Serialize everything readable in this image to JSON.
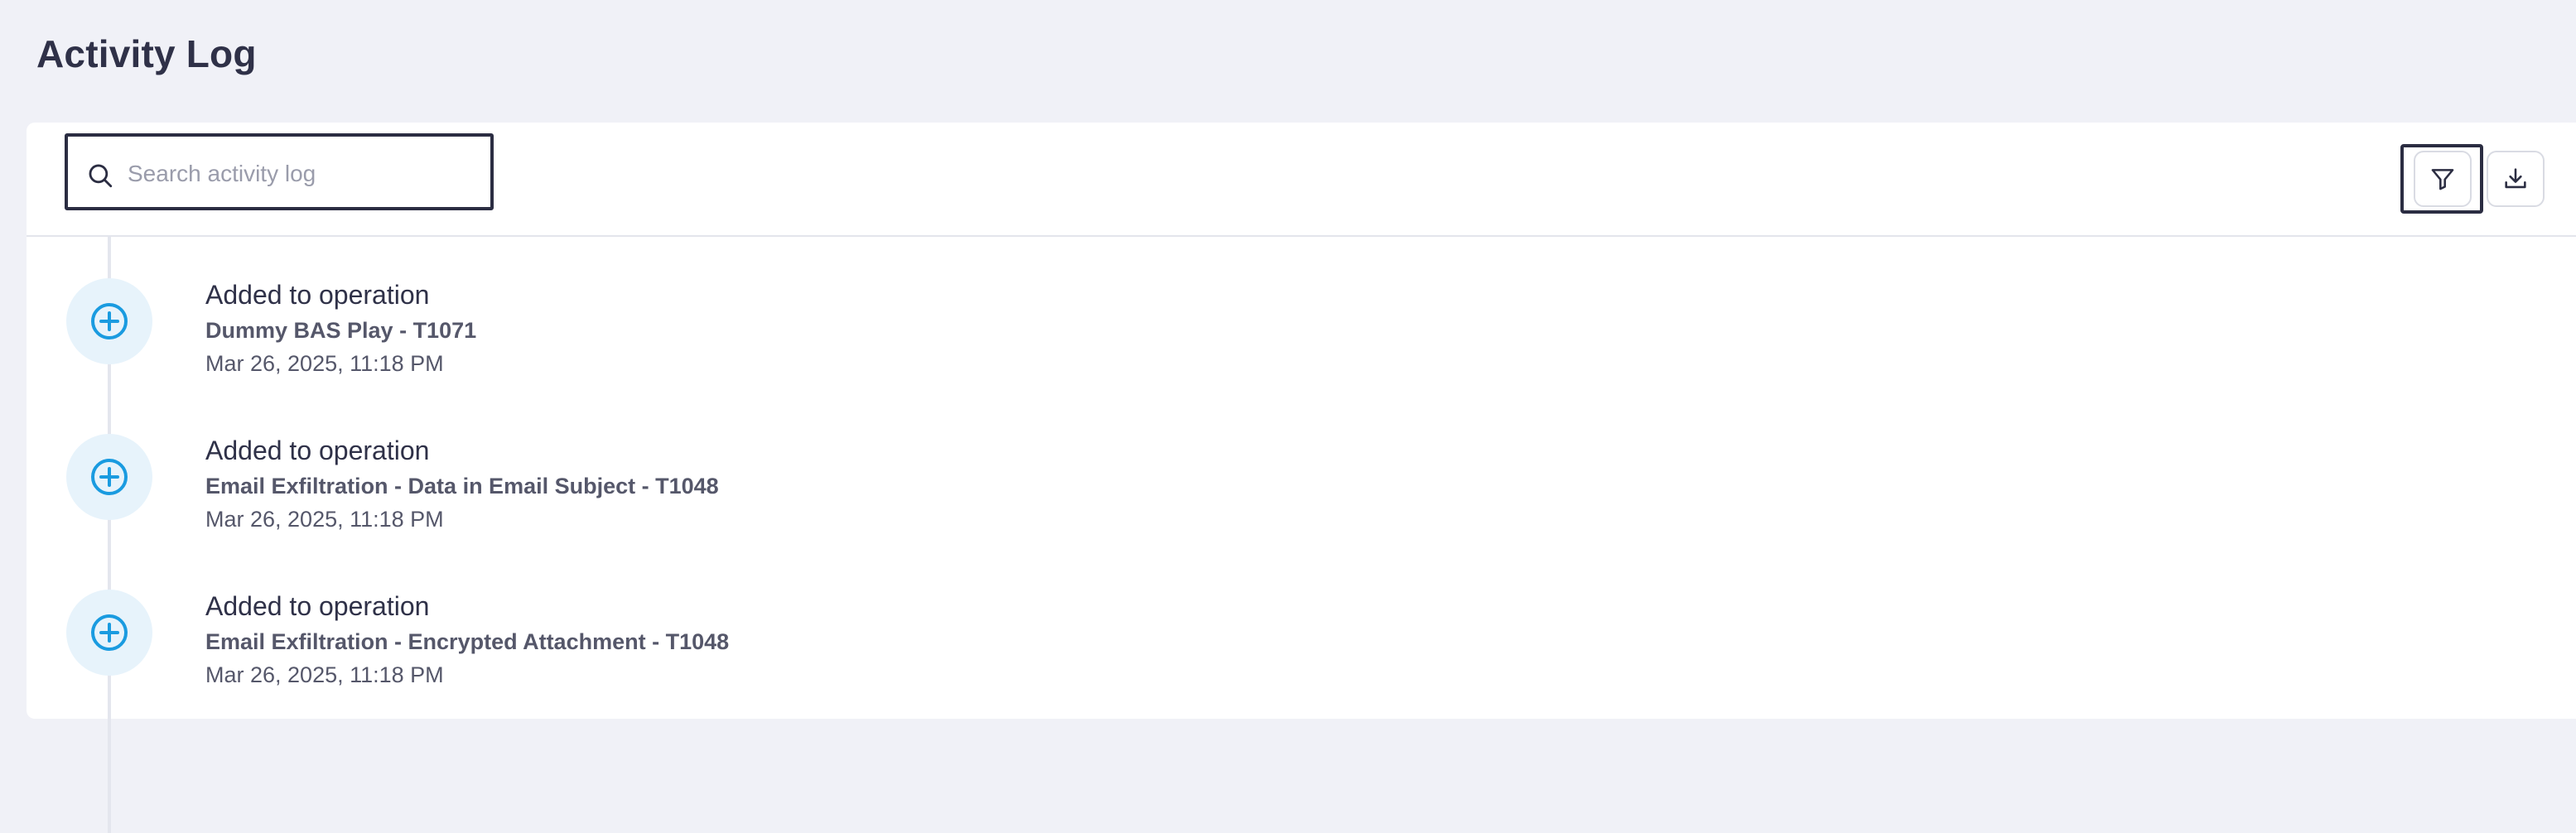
{
  "page": {
    "title": "Activity Log"
  },
  "toolbar": {
    "search": {
      "placeholder": "Search activity log",
      "value": ""
    },
    "filter_icon": "filter-icon",
    "download_icon": "download-icon"
  },
  "entries": [
    {
      "icon": "plus-circle-icon",
      "title": "Added to operation",
      "subtitle": "Dummy BAS Play - T1071",
      "timestamp": "Mar 26, 2025, 11:18 PM"
    },
    {
      "icon": "plus-circle-icon",
      "title": "Added to operation",
      "subtitle": "Email Exfiltration - Data in Email Subject - T1048",
      "timestamp": "Mar 26, 2025, 11:18 PM"
    },
    {
      "icon": "plus-circle-icon",
      "title": "Added to operation",
      "subtitle": "Email Exfiltration - Encrypted Attachment - T1048",
      "timestamp": "Mar 26, 2025, 11:18 PM"
    }
  ],
  "colors": {
    "background": "#f0f1f7",
    "card": "#ffffff",
    "accent": "#1a9be0",
    "icon_bg": "#e7f3fb",
    "text_primary": "#2f3148",
    "text_secondary": "#55576a",
    "focus_border": "#2b2d42"
  }
}
